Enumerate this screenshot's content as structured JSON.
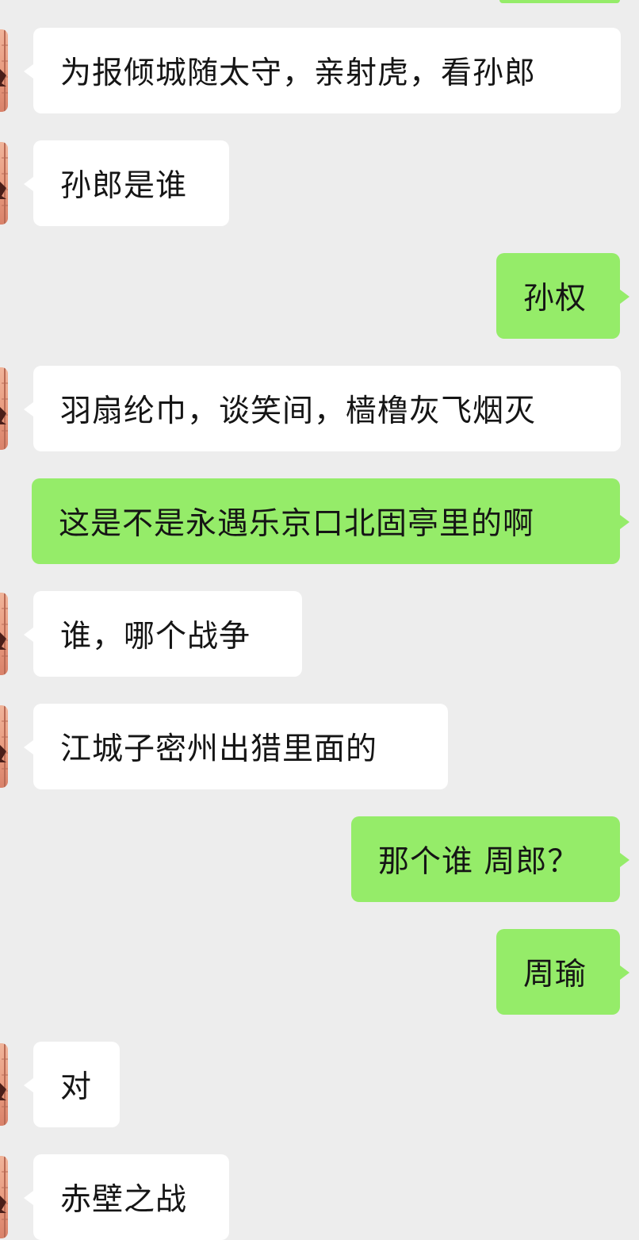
{
  "colors": {
    "background": "#ededed",
    "incoming_bubble": "#ffffff",
    "outgoing_bubble": "#95ec69",
    "text": "#151515"
  },
  "messages": [
    {
      "side": "in",
      "text": "为报倾城随太守，亲射虎，看孙郎"
    },
    {
      "side": "in",
      "text": "孙郎是谁"
    },
    {
      "side": "out",
      "text": "孙权"
    },
    {
      "side": "in",
      "text": "羽扇纶巾，谈笑间，樯橹灰飞烟灭"
    },
    {
      "side": "out",
      "text": "这是不是永遇乐京口北固亭里的啊"
    },
    {
      "side": "in",
      "text": "谁，哪个战争"
    },
    {
      "side": "in",
      "text": "江城子密州出猎里面的"
    },
    {
      "side": "out",
      "text": "那个谁 周郎？"
    },
    {
      "side": "out",
      "text": "周瑜"
    },
    {
      "side": "in",
      "text": "对"
    },
    {
      "side": "in",
      "text": "赤壁之战"
    }
  ]
}
